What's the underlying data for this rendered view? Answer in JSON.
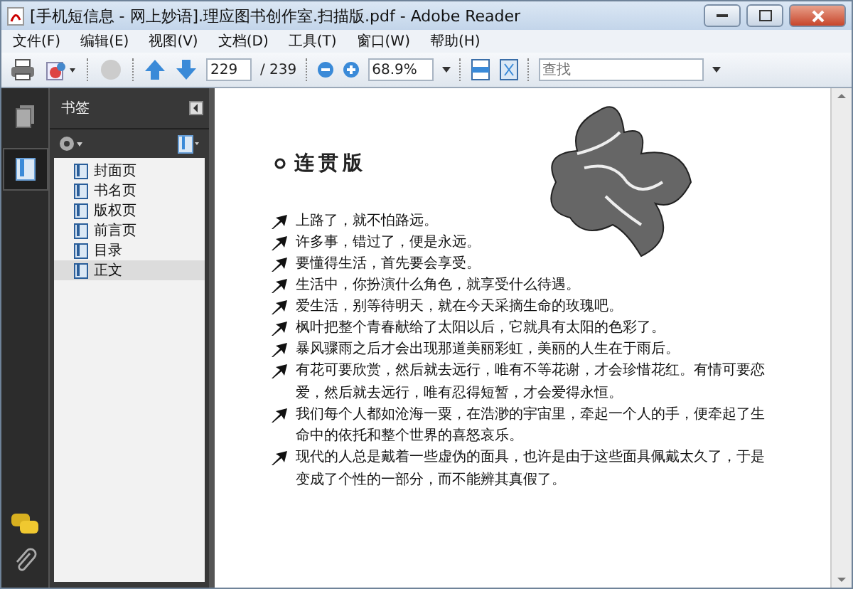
{
  "window": {
    "title": "[手机短信息 - 网上妙语].理应图书创作室.扫描版.pdf - Adobe Reader"
  },
  "menu": [
    "文件(F)",
    "编辑(E)",
    "视图(V)",
    "文档(D)",
    "工具(T)",
    "窗口(W)",
    "帮助(H)"
  ],
  "toolbar": {
    "page": "229",
    "page_total": "/ 239",
    "zoom": "68.9%",
    "search": {
      "placeholder": "查找"
    }
  },
  "sidebar": {
    "title": "书签",
    "bookmarks": [
      {
        "label": "封面页",
        "selected": false
      },
      {
        "label": "书名页",
        "selected": false
      },
      {
        "label": "版权页",
        "selected": false
      },
      {
        "label": "前言页",
        "selected": false
      },
      {
        "label": "目录",
        "selected": false
      },
      {
        "label": "正文",
        "selected": true
      }
    ]
  },
  "document": {
    "heading": "连贯版",
    "paragraphs": [
      "上路了，就不怕路远。",
      "许多事，错过了，便是永远。",
      "要懂得生活，首先要会享受。",
      "生活中，你扮演什么角色，就享受什么待遇。",
      "爱生活，别等待明天，就在今天采摘生命的玫瑰吧。",
      "枫叶把整个青春献给了太阳以后，它就具有太阳的色彩了。",
      "暴风骤雨之后才会出现那道美丽彩虹，美丽的人生在于雨后。",
      "有花可要欣赏，然后就去远行，唯有不等花谢，才会珍惜花红。有情可要恋爱，然后就去远行，唯有忍得短暂，才会爱得永恒。",
      "我们每个人都如沧海一粟，在浩渺的宇宙里，牵起一个人的手，便牵起了生命中的依托和整个世界的喜怒哀乐。",
      "现代的人总是戴着一些虚伪的面具，也许是由于这些面具佩戴太久了，于是变成了个性的一部分，而不能辨其真假了。"
    ]
  }
}
